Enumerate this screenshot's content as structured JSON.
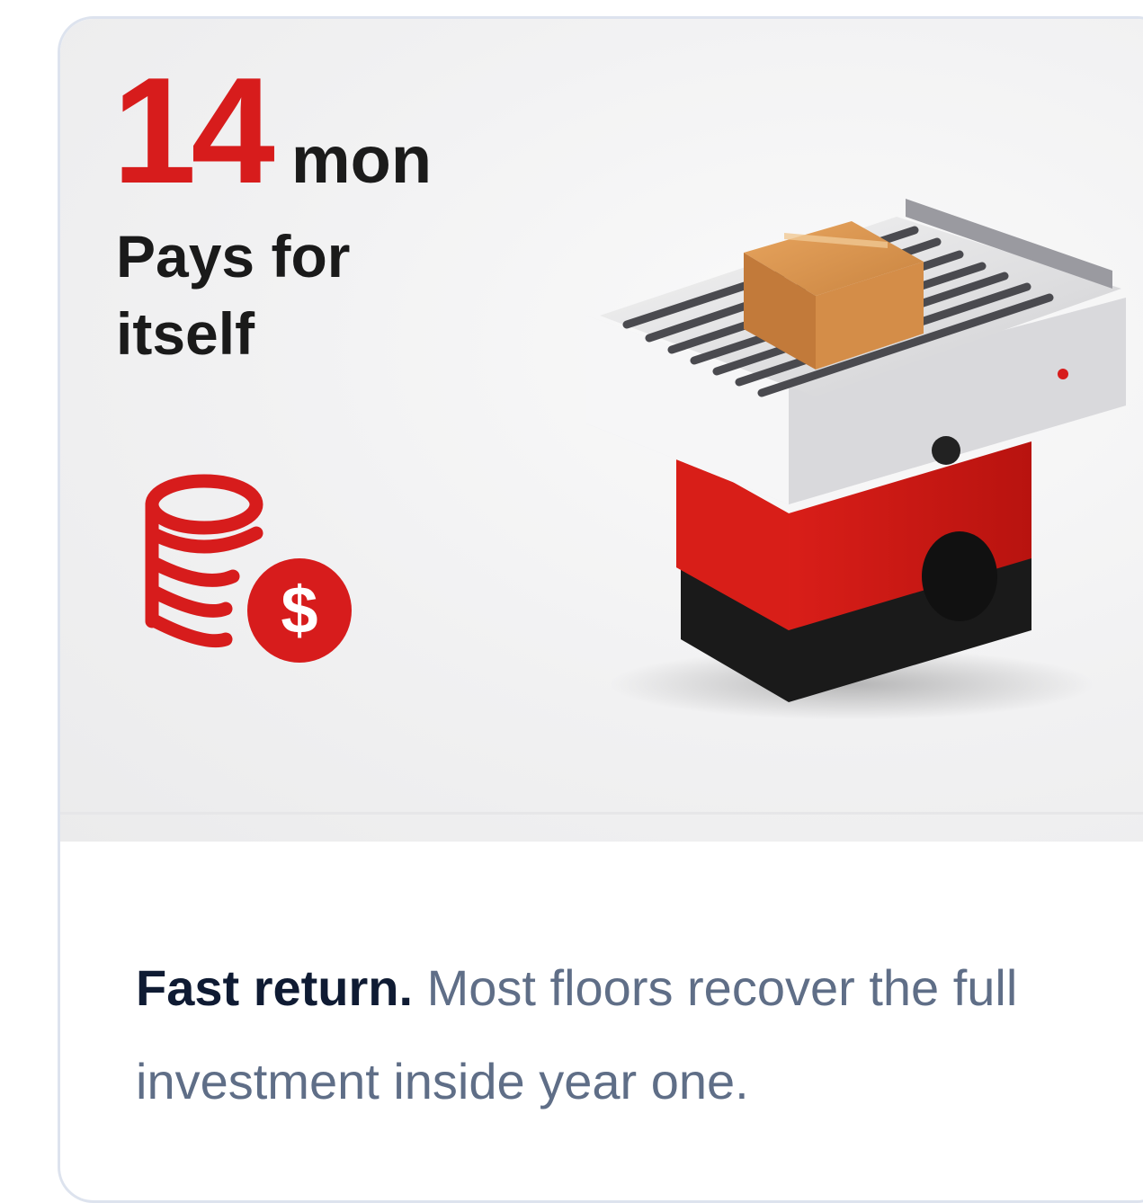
{
  "card": {
    "stat_number": "14",
    "stat_unit": "mon",
    "subtitle": "Pays for itself",
    "caption_lead": "Fast return.",
    "caption_body": " Most floors recover the full investment inside year one."
  },
  "icons": {
    "coins": "coins-dollar-icon",
    "robot": "conveyor-robot-illustration"
  },
  "colors": {
    "accent": "#d71c1c",
    "heading": "#0f1b33",
    "body": "#5f6e87"
  }
}
